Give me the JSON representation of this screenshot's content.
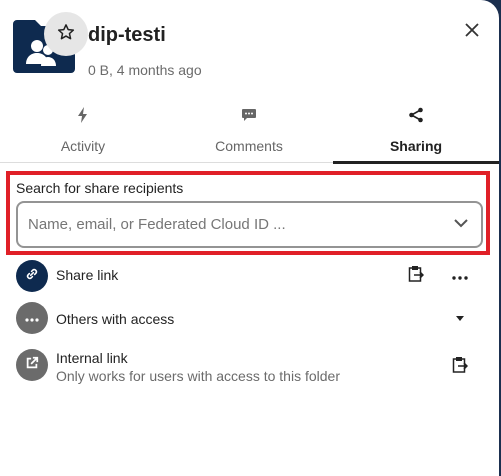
{
  "file": {
    "name": "dip-testi",
    "meta": "0 B, 4 months ago"
  },
  "tabs": [
    {
      "label": "Activity",
      "icon": "activity-icon"
    },
    {
      "label": "Comments",
      "icon": "comments-icon"
    },
    {
      "label": "Sharing",
      "icon": "share-icon",
      "active": true
    }
  ],
  "search": {
    "label": "Search for share recipients",
    "placeholder": "Name, email, or Federated Cloud ID ..."
  },
  "shares": {
    "share_link": {
      "title": "Share link"
    },
    "others": {
      "title": "Others with access"
    },
    "internal": {
      "title": "Internal link",
      "subtitle": "Only works for users with access to this folder"
    }
  },
  "colors": {
    "primary": "#0e2a4f",
    "highlight": "#e02027",
    "grey_avatar": "#6b6b6b"
  }
}
